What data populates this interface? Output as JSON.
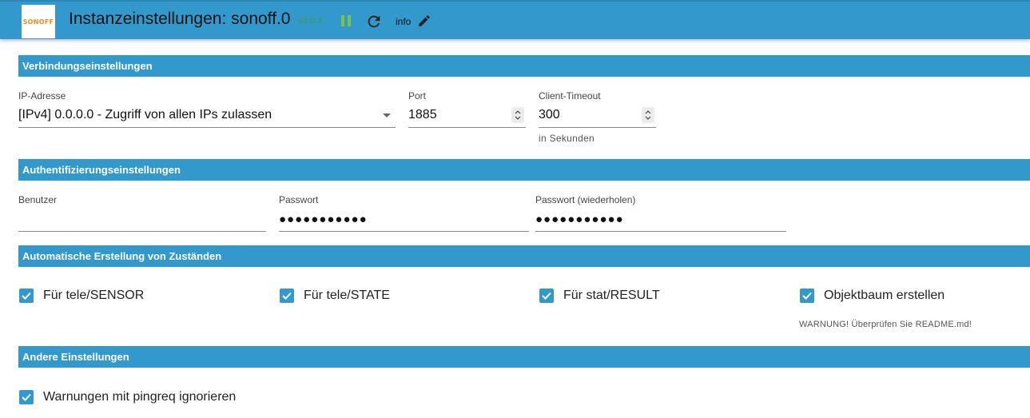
{
  "header": {
    "logo_text": "SONOFF",
    "title": "Instanzeinstellungen: sonoff.0",
    "version": "v3.0.3",
    "info_label": "info",
    "bar_color": "#3399cc",
    "pause_icon_color": "#7dc242"
  },
  "sections": {
    "connection": {
      "title": "Verbindungseinstellungen",
      "ip_label": "IP-Adresse",
      "ip_value": "[IPv4] 0.0.0.0 - Zugriff von allen IPs zulassen",
      "port_label": "Port",
      "port_value": "1885",
      "timeout_label": "Client-Timeout",
      "timeout_value": "300",
      "timeout_helper": "in Sekunden"
    },
    "auth": {
      "title": "Authentifizierungseinstellungen",
      "user_label": "Benutzer",
      "user_value": "",
      "password_label": "Passwort",
      "password_value": "●●●●●●●●●●●",
      "password_repeat_label": "Passwort (wiederholen)",
      "password_repeat_value": "●●●●●●●●●●●"
    },
    "auto_states": {
      "title": "Automatische Erstellung von Zuständen",
      "tele_sensor": "Für tele/SENSOR",
      "tele_state": "Für tele/STATE",
      "stat_result": "Für stat/RESULT",
      "object_tree": "Objektbaum erstellen",
      "warning": "WARNUNG! Überprüfen Sie README.md!"
    },
    "other": {
      "title": "Andere Einstellungen",
      "ignore_pingreq": "Warnungen mit pingreq ignorieren"
    }
  }
}
